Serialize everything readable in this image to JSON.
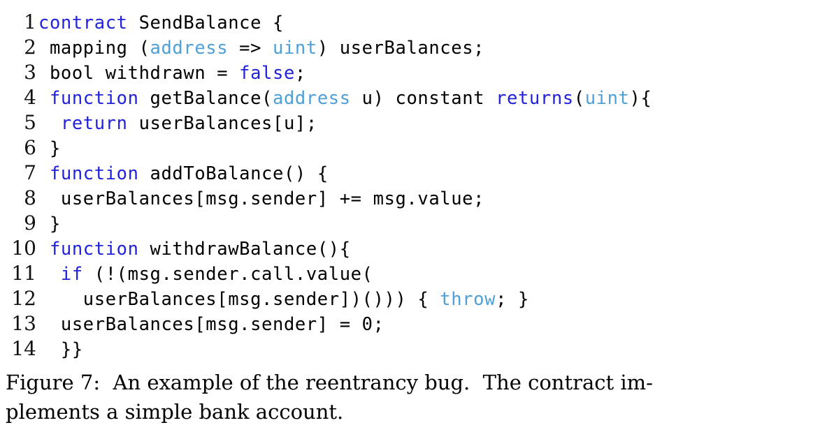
{
  "figure": {
    "caption_lines": [
      "Figure 7:  An example of the reentrancy bug.  The contract im-",
      "plements a simple bank account."
    ],
    "caption_full": "Figure 7: An example of the reentrancy bug. The contract implements a simple bank account.",
    "language": "solidity",
    "colors": {
      "background": "#ffffff",
      "text": "#000000",
      "line_number": "#111111",
      "keyword": "#2222dd",
      "type": "#4fa0d8"
    }
  },
  "code": {
    "lines": [
      {
        "number": "1",
        "text": "contract SendBalance {",
        "tokens": [
          {
            "t": "contract",
            "c": "kw"
          },
          {
            "t": " SendBalance {",
            "c": "plain"
          }
        ]
      },
      {
        "number": "2",
        "text": " mapping (address => uint) userBalances;",
        "tokens": [
          {
            "t": " mapping (",
            "c": "plain"
          },
          {
            "t": "address",
            "c": "type"
          },
          {
            "t": " => ",
            "c": "plain"
          },
          {
            "t": "uint",
            "c": "type"
          },
          {
            "t": ") userBalances;",
            "c": "plain"
          }
        ]
      },
      {
        "number": "3",
        "text": " bool withdrawn = false;",
        "tokens": [
          {
            "t": " bool withdrawn = ",
            "c": "plain"
          },
          {
            "t": "false",
            "c": "kw"
          },
          {
            "t": ";",
            "c": "plain"
          }
        ]
      },
      {
        "number": "4",
        "text": " function getBalance(address u) constant returns(uint){",
        "tokens": [
          {
            "t": " ",
            "c": "plain"
          },
          {
            "t": "function",
            "c": "kw"
          },
          {
            "t": " getBalance(",
            "c": "plain"
          },
          {
            "t": "address",
            "c": "type"
          },
          {
            "t": " u) constant ",
            "c": "plain"
          },
          {
            "t": "returns",
            "c": "kw"
          },
          {
            "t": "(",
            "c": "plain"
          },
          {
            "t": "uint",
            "c": "type"
          },
          {
            "t": "){",
            "c": "plain"
          }
        ]
      },
      {
        "number": "5",
        "text": "  return userBalances[u];",
        "tokens": [
          {
            "t": "  ",
            "c": "plain"
          },
          {
            "t": "return",
            "c": "kw"
          },
          {
            "t": " userBalances[u];",
            "c": "plain"
          }
        ]
      },
      {
        "number": "6",
        "text": " }",
        "tokens": [
          {
            "t": " }",
            "c": "plain"
          }
        ]
      },
      {
        "number": "7",
        "text": " function addToBalance() {",
        "tokens": [
          {
            "t": " ",
            "c": "plain"
          },
          {
            "t": "function",
            "c": "kw"
          },
          {
            "t": " addToBalance() {",
            "c": "plain"
          }
        ]
      },
      {
        "number": "8",
        "text": "  userBalances[msg.sender] += msg.value;",
        "tokens": [
          {
            "t": "  userBalances[msg.sender] += msg.value;",
            "c": "plain"
          }
        ]
      },
      {
        "number": "9",
        "text": " }",
        "tokens": [
          {
            "t": " }",
            "c": "plain"
          }
        ]
      },
      {
        "number": "10",
        "text": " function withdrawBalance(){",
        "tokens": [
          {
            "t": " ",
            "c": "plain"
          },
          {
            "t": "function",
            "c": "kw"
          },
          {
            "t": " withdrawBalance(){",
            "c": "plain"
          }
        ]
      },
      {
        "number": "11",
        "text": "  if (!(msg.sender.call.value(",
        "tokens": [
          {
            "t": "  ",
            "c": "plain"
          },
          {
            "t": "if",
            "c": "kw"
          },
          {
            "t": " (!(msg.sender.call.value(",
            "c": "plain"
          }
        ]
      },
      {
        "number": "12",
        "text": "    userBalances[msg.sender])())) { throw; }",
        "tokens": [
          {
            "t": "    userBalances[msg.sender])())) { ",
            "c": "plain"
          },
          {
            "t": "throw",
            "c": "type"
          },
          {
            "t": "; }",
            "c": "plain"
          }
        ]
      },
      {
        "number": "13",
        "text": "  userBalances[msg.sender] = 0;",
        "tokens": [
          {
            "t": "  userBalances[msg.sender] = 0;",
            "c": "plain"
          }
        ]
      },
      {
        "number": "14",
        "text": "  }}",
        "tokens": [
          {
            "t": "  }}",
            "c": "plain"
          }
        ]
      }
    ]
  }
}
